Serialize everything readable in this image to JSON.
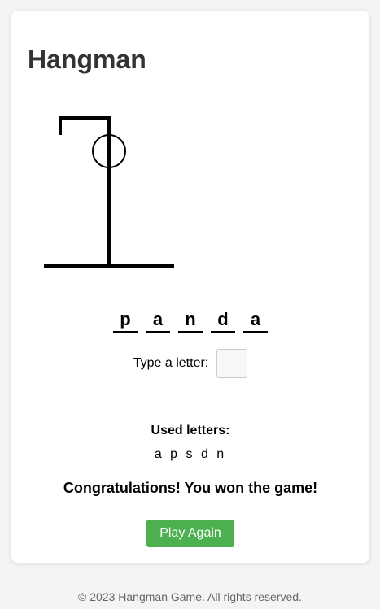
{
  "app": {
    "title": "Hangman"
  },
  "word": {
    "letters": [
      "p",
      "a",
      "n",
      "d",
      "a"
    ]
  },
  "input": {
    "label": "Type a letter:",
    "value": ""
  },
  "used": {
    "title": "Used letters:",
    "letters": "a p s d n"
  },
  "status": {
    "message": "Congratulations! You won the game!"
  },
  "actions": {
    "play_again_label": "Play Again"
  },
  "footer": {
    "text": "© 2023 Hangman Game. All rights reserved."
  },
  "colors": {
    "button_bg": "#4caf50",
    "button_text": "#ffffff",
    "title_text": "#333333",
    "page_bg": "#f4f4f4"
  }
}
